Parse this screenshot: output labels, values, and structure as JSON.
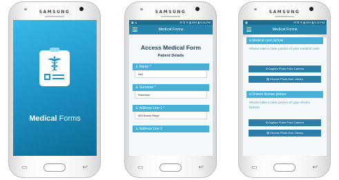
{
  "device": {
    "brand": "SAMSUNG"
  },
  "splash": {
    "title_bold": "Medical",
    "title_light": "Forms"
  },
  "form_screen": {
    "status_left": "▣ ▲",
    "status_right": "✉ ⇅ ▼.▮ 59% ▮ 5:16 PM",
    "appbar_title": "Medical Forms",
    "title": "Access Medical Form",
    "subtitle": "Patient Details",
    "fields": [
      {
        "label": "Name *",
        "value": "Neil"
      },
      {
        "label": "Surname *",
        "value": "Roberson"
      },
      {
        "label": "Address Line 1 *",
        "value": "405 Bushe Ridge"
      },
      {
        "label": "Address Line 2",
        "value": ""
      }
    ]
  },
  "photo_screen": {
    "status_left": "▣",
    "status_right": "✉ ⇅ ▼.▮ 59% ▮ 5:16 PM",
    "appbar_title": "Medical Forms",
    "sections": [
      {
        "heading": "Medical card picture",
        "instruction": "Please take a clear picture of your medical card",
        "camera_button": "Capture Photo From Camera",
        "library_button": "Choose Photo from Library"
      },
      {
        "heading": "Drivers license picture",
        "instruction": "Please take a clear picture of your drivers license",
        "camera_button": "Capture Photo From Camera",
        "library_button": "Choose Photo from Library"
      }
    ]
  },
  "colors": {
    "splash_gradient_start": "#37b9e6",
    "splash_gradient_end": "#0a6c96",
    "appbar": "#2784ad",
    "field_header": "#48b0d6",
    "button": "#2a7ea8",
    "instruction_text": "#3aa0c8"
  },
  "icons": {
    "logo": "medical-caduceus-clipboard-icon",
    "menu": "hamburger-menu-icon",
    "field": "person-icon",
    "camera": "camera-icon",
    "library": "image-icon"
  }
}
